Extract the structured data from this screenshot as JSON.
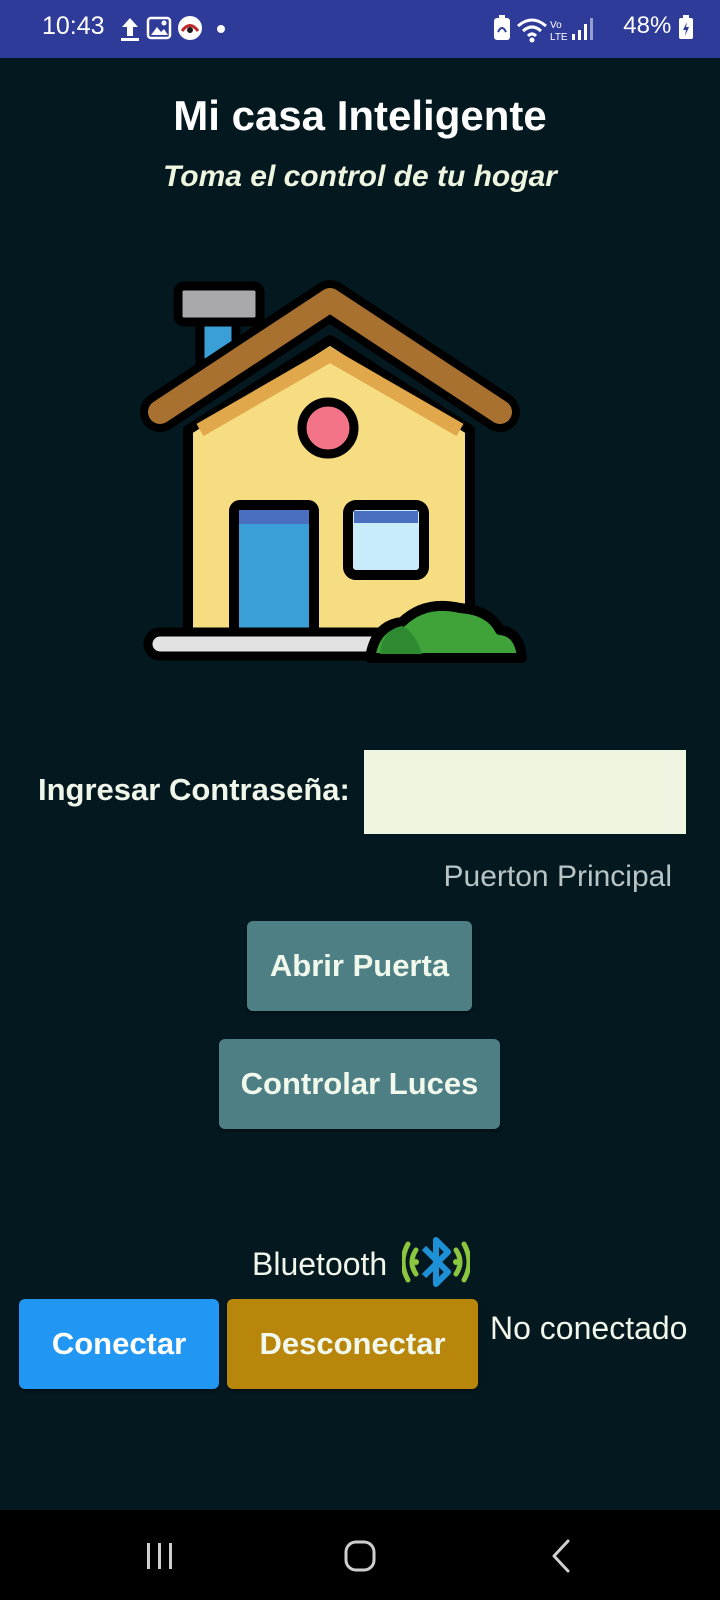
{
  "status_bar": {
    "time": "10:43",
    "left_icons": [
      "upload-icon",
      "gallery-icon",
      "app-notification-icon",
      "dot-icon"
    ],
    "right_icons": [
      "battery-saver-icon",
      "wifi-icon",
      "volte-icon",
      "signal-icon"
    ],
    "battery": "48%"
  },
  "header": {
    "title": "Mi casa Inteligente",
    "subtitle": "Toma el control de tu hogar"
  },
  "illustration": {
    "icon": "house-icon"
  },
  "password": {
    "label": "Ingresar Contraseña:",
    "value": "",
    "placeholder": ""
  },
  "door": {
    "label": "Puerton Principal",
    "open_button": "Abrir Puerta"
  },
  "lights": {
    "button": "Controlar Luces"
  },
  "bluetooth": {
    "label": "Bluetooth",
    "icon": "bluetooth-icon",
    "connect_button": "Conectar",
    "disconnect_button": "Desconectar",
    "status": "No conectado"
  },
  "nav_bar": {
    "items": [
      "recent-apps-icon",
      "home-icon",
      "back-icon"
    ]
  },
  "colors": {
    "background": "#041820",
    "status_bar": "#2f3b98",
    "teal_button": "#4d7f84",
    "connect_button": "#2196f3",
    "disconnect_button": "#b8860b",
    "input_background": "#eef5e0"
  }
}
